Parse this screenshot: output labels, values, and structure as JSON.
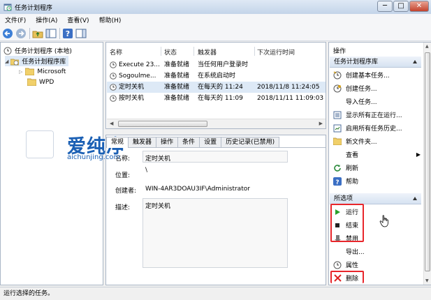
{
  "window": {
    "title": "任务计划程序"
  },
  "window_controls": {
    "minimize": "─",
    "maximize": "□",
    "close": "✕"
  },
  "menu": [
    "文件(F)",
    "操作(A)",
    "查看(V)",
    "帮助(H)"
  ],
  "tree": {
    "root": "任务计划程序 (本地)",
    "library": "任务计划程序库",
    "children": [
      "Microsoft",
      "WPD"
    ]
  },
  "task_list": {
    "columns": [
      "名称",
      "状态",
      "触发器",
      "下次运行时间"
    ],
    "rows": [
      {
        "name": "Execute 23...",
        "status": "准备就绪",
        "trigger": "当任何用户登录时",
        "next": ""
      },
      {
        "name": "Sogoulme...",
        "status": "准备就绪",
        "trigger": "在系统启动时",
        "next": ""
      },
      {
        "name": "定时关机",
        "status": "准备就绪",
        "trigger": "在每天的 11:24",
        "next": "2018/11/8 11:24:05"
      },
      {
        "name": "按时关机",
        "status": "准备就绪",
        "trigger": "在每天的 11:09",
        "next": "2018/11/11 11:09:03"
      }
    ],
    "selected_index": 2
  },
  "detail": {
    "tabs": [
      "常规",
      "触发器",
      "操作",
      "条件",
      "设置",
      "历史记录(已禁用)"
    ],
    "active_tab": 0,
    "name_label": "名称:",
    "name_value": "定时关机",
    "location_label": "位置:",
    "location_value": "\\",
    "author_label": "创建者:",
    "author_value": "WIN-4AR3DOAU3IF\\Administrator",
    "desc_label": "描述:",
    "desc_value": "定时关机"
  },
  "actions": {
    "header": "操作",
    "section1": "任务计划程序库",
    "items1": [
      "创建基本任务...",
      "创建任务...",
      "导入任务...",
      "显示所有正在运行...",
      "启用所有任务历史...",
      "新文件夹...",
      "查看",
      "刷新",
      "帮助"
    ],
    "section2": "所选项",
    "items2": [
      "运行",
      "结束",
      "禁用",
      "导出...",
      "属性",
      "删除"
    ]
  },
  "watermark": {
    "brand": "爱纯净",
    "url": "aichunjing.com"
  },
  "status": "运行选择的任务。",
  "colors": {
    "highlight": "#e8262b",
    "selection": "#dde9f6",
    "header": "#d6e2f1"
  }
}
